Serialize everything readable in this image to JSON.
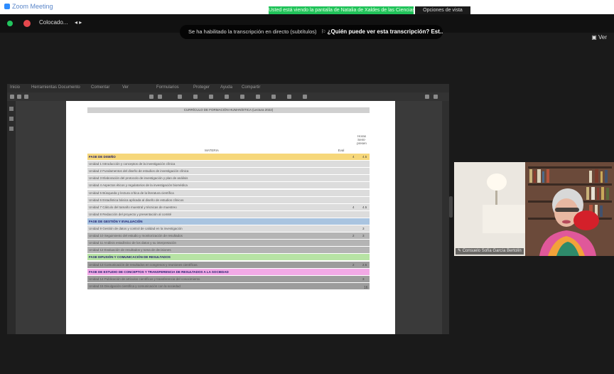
{
  "window": {
    "app_title": "Zoom Meeting"
  },
  "banner": {
    "sharing_text": "Usted está viendo la pantalla de Natalia de Xaldes de las Ciencias",
    "view_options": "Opciones de vista"
  },
  "meeting_bar": {
    "participant_label": "Colocado...",
    "top_right": "Ver"
  },
  "speaker_chip": {
    "prefix": "Se ha habilitado la transcripción en directo (subtítulos)",
    "question": "¿Quién puede ver esta transcripción? Est..."
  },
  "viewer": {
    "menus": [
      "Inicio",
      "Herramientas",
      "Documento",
      "Comentar",
      "Ver",
      "Formularios",
      "Proteger",
      "Ayuda",
      "Compartir"
    ]
  },
  "document": {
    "title": "CURRÍCULO DE FORMACIÓN HUMANÍSTICA (Lectura 2022)",
    "headers": {
      "materia": "MATERIA",
      "eval": "Eval",
      "horas": "Horas Semi-presen"
    },
    "rows": [
      {
        "text": "FASE DE DISEÑO",
        "phase": true,
        "color": "#f6d77a",
        "v1": "4",
        "v2": "4.5"
      },
      {
        "text": "Unidad 1 Introducción y conceptos de la investigación clínica",
        "color": "#dcdcdc"
      },
      {
        "text": "Unidad 2 Fundamentos del diseño de estudios de investigación clínica",
        "color": "#dcdcdc"
      },
      {
        "text": "Unidad 3 Elaboración del protocolo de investigación y plan de análisis",
        "color": "#dcdcdc"
      },
      {
        "text": "Unidad 4 Aspectos éticos y regulatorios de la investigación biomédica",
        "color": "#dcdcdc"
      },
      {
        "text": "Unidad 5 Búsqueda y lectura crítica de la literatura científica",
        "color": "#dcdcdc"
      },
      {
        "text": "Unidad 6 Estadística básica aplicada al diseño de estudios clínicos",
        "color": "#dcdcdc"
      },
      {
        "text": "Unidad 7 Cálculo del tamaño muestral y técnicas de muestreo",
        "color": "#dcdcdc",
        "v1": "4",
        "v2": "4.5"
      },
      {
        "text": "Unidad 8 Redacción del proyecto y presentación al comité",
        "color": "#dcdcdc"
      },
      {
        "text": "FASE DE GESTIÓN Y EVALUACIÓN",
        "phase": true,
        "color": "#a9c4e0"
      },
      {
        "text": "Unidad 9 Gestión de datos y control de calidad en la investigación",
        "color": "#dcdcdc",
        "v2": "3"
      },
      {
        "text": "Unidad 10 Seguimiento del estudio y monitorización de resultados",
        "color": "#b4b4b4",
        "v1": "2",
        "v2": "3"
      },
      {
        "text": "Unidad 11 Análisis estadístico de los datos y su interpretación",
        "color": "#b4b4b4"
      },
      {
        "text": "Unidad 12 Evaluación de resultados y toma de decisiones",
        "color": "#b4b4b4"
      },
      {
        "text": "FASE DIFUSIÓN Y COMUNICACIÓN DE RESULTADOS",
        "phase": true,
        "color": "#b7e3a4"
      },
      {
        "text": "Unidad 13 Comunicación de resultados en congresos y reuniones científicas",
        "color": "#9c9c9c",
        "v1": "2",
        "v2": "2.5"
      },
      {
        "text": "FASE DE ESTUDIO DE CONCEPTOS Y TRANSFERENCIA DE RESULTADOS A LA SOCIEDAD",
        "phase": true,
        "color": "#f2a9e6"
      },
      {
        "text": "Unidad 14 Publicación de artículos científicos y transferencia del conocimiento",
        "color": "#9c9c9c",
        "v2": "3"
      },
      {
        "text": "Unidad 15 Divulgación científica y comunicación con la sociedad",
        "color": "#9c9c9c"
      }
    ],
    "total": "16"
  },
  "video": {
    "participant_name": "Consuelo Sofía García Bertolín"
  },
  "colors": {
    "zoom_blue": "#2d8cff",
    "share_green": "#21c35a",
    "background": "#1a1a1a"
  }
}
